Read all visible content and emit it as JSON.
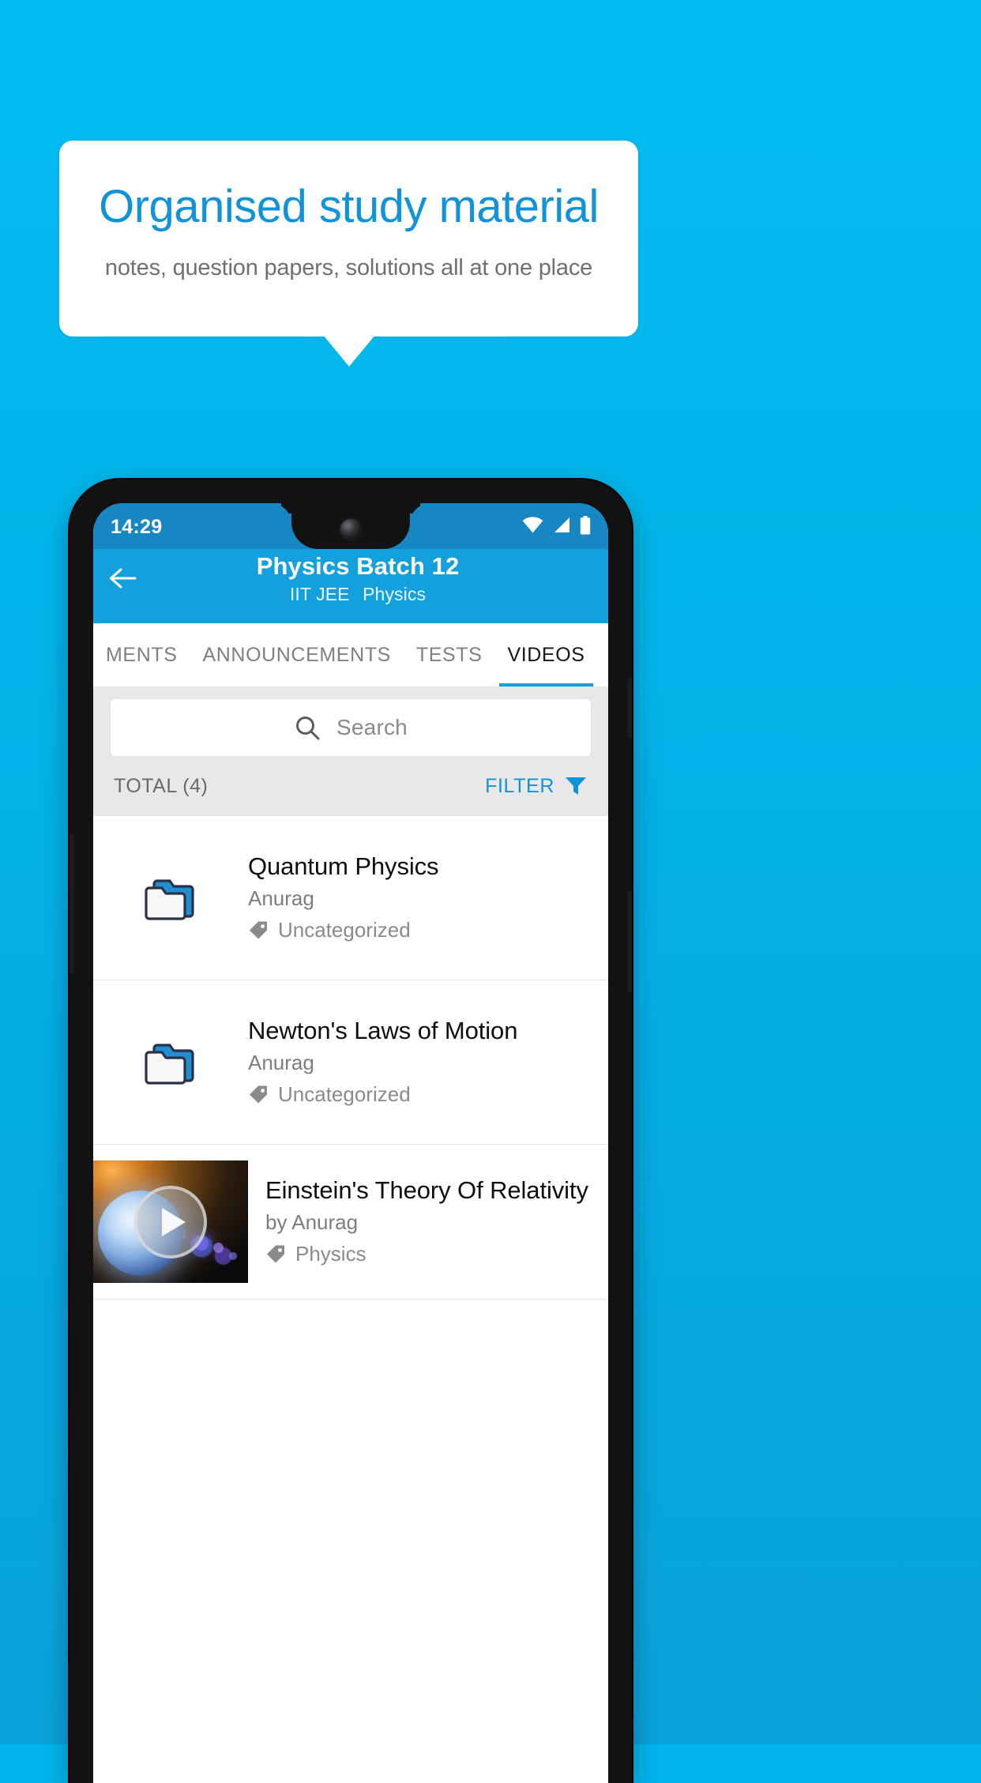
{
  "promo": {
    "title": "Organised study material",
    "subtitle": "notes, question papers, solutions all at one place",
    "title_color": "#1093d8",
    "subtitle_color": "#707070",
    "background_color": "#00b5ec"
  },
  "phone": {
    "status_bar": {
      "clock": "14:29",
      "icons": [
        "wifi-icon",
        "signal-icon",
        "battery-icon"
      ],
      "background_color": "#1787c4"
    },
    "app_bar": {
      "back_icon": "back-arrow-icon",
      "title": "Physics Batch 12",
      "exam": "IIT JEE",
      "subject": "Physics",
      "background_color": "#14a0dd"
    },
    "tabs": [
      {
        "label": "MENTS",
        "active": false
      },
      {
        "label": "ANNOUNCEMENTS",
        "active": false
      },
      {
        "label": "TESTS",
        "active": false
      },
      {
        "label": "VIDEOS",
        "active": true
      }
    ],
    "search": {
      "placeholder": "Search",
      "icon": "search-icon"
    },
    "summary": {
      "total_label": "TOTAL (4)",
      "filter_label": "FILTER",
      "filter_icon": "filter-funnel-icon",
      "filter_color": "#1094d9"
    },
    "list": [
      {
        "type": "folder",
        "icon": "folder-icon",
        "title": "Quantum Physics",
        "author": "Anurag",
        "tag_icon": "tag-icon",
        "tag": "Uncategorized"
      },
      {
        "type": "folder",
        "icon": "folder-icon",
        "title": "Newton's Laws of Motion",
        "author": "Anurag",
        "tag_icon": "tag-icon",
        "tag": "Uncategorized"
      },
      {
        "type": "video",
        "icon": "video-thumbnail",
        "play_icon": "play-icon",
        "title": "Einstein's Theory Of Relativity",
        "author": "by Anurag",
        "tag_icon": "tag-icon",
        "tag": "Physics"
      }
    ]
  }
}
